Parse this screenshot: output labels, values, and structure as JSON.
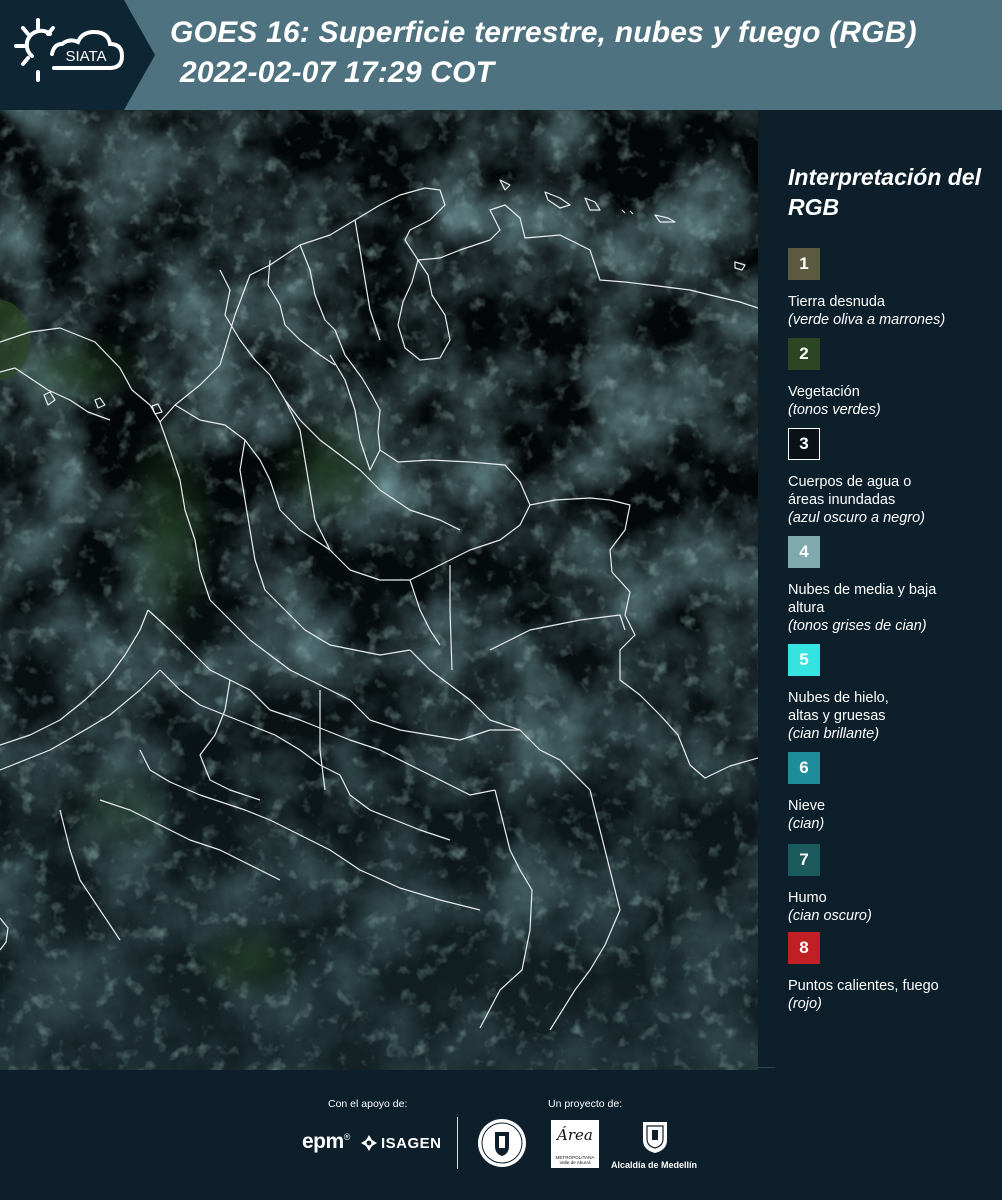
{
  "header": {
    "logo_text": "SIATA",
    "title": "GOES 16: Superficie terrestre, nubes y fuego (RGB)",
    "datetime": "2022-02-07 17:29 COT"
  },
  "map": {
    "background_color": "#030708",
    "border_color": "#e8ecef"
  },
  "legend": {
    "title": "Interpretación del RGB",
    "items": [
      {
        "number": "1",
        "label": "Tierra desnuda",
        "note": "(verde oliva a marrones)",
        "color": "#5c5b3f"
      },
      {
        "number": "2",
        "label": "Vegetación",
        "note": "(tonos verdes)",
        "color": "#2c4523"
      },
      {
        "number": "3",
        "label": "Cuerpos de agua o áreas inundadas",
        "note": "(azul oscuro a negro)",
        "color": "#0a1217"
      },
      {
        "number": "4",
        "label": "Nubes de media y baja altura",
        "note": "(tonos grises de cian)",
        "color": "#7fa9ac"
      },
      {
        "number": "5",
        "label": "Nubes de hielo, altas y gruesas",
        "note": "(cian brillante)",
        "color": "#35e3e0"
      },
      {
        "number": "6",
        "label": "Nieve",
        "note": "(cian)",
        "color": "#1f8c9b"
      },
      {
        "number": "7",
        "label": "Humo",
        "note": "(cian oscuro)",
        "color": "#1d5a5e"
      },
      {
        "number": "8",
        "label": "Puntos calientes, fuego",
        "note": "(rojo)",
        "color": "#c01f23"
      }
    ]
  },
  "footer": {
    "support_label": "Con el apoyo de:",
    "project_label": "Un proyecto de:",
    "epm": "epm",
    "isagen": "ISAGEN",
    "area_script": "Área",
    "area_caption": "METROPOLITANA Valle de Aburrá",
    "medellin": "Alcaldía de Medellín"
  }
}
